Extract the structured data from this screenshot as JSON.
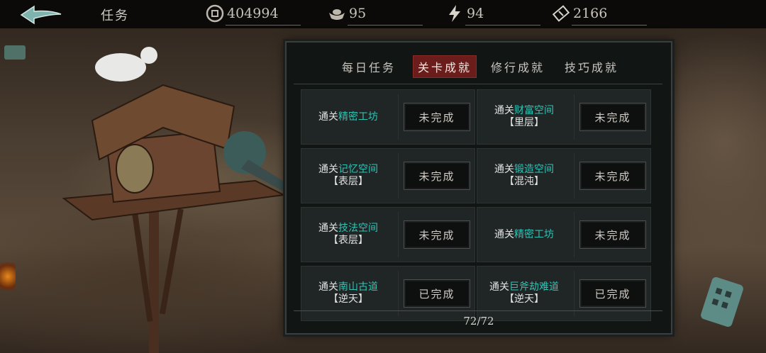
{
  "header": {
    "title": "任务",
    "resources": [
      {
        "icon": "coin-icon",
        "value": "404994"
      },
      {
        "icon": "silver-ingot-icon",
        "value": "95"
      },
      {
        "icon": "lightning-icon",
        "value": "94"
      },
      {
        "icon": "ticket-icon",
        "value": "2166"
      }
    ]
  },
  "tabs": [
    {
      "label": "每日任务",
      "active": false
    },
    {
      "label": "关卡成就",
      "active": true
    },
    {
      "label": "修行成就",
      "active": false
    },
    {
      "label": "技巧成就",
      "active": false
    }
  ],
  "achievements": [
    {
      "prefix": "通关",
      "name": "精密工坊",
      "tier": "",
      "status": "未完成"
    },
    {
      "prefix": "通关",
      "name": "财富空间",
      "tier": "【里层】",
      "status": "未完成"
    },
    {
      "prefix": "通关",
      "name": "记忆空间",
      "tier": "【表层】",
      "status": "未完成"
    },
    {
      "prefix": "通关",
      "name": "锻造空间",
      "tier": "【混沌】",
      "status": "未完成"
    },
    {
      "prefix": "通关",
      "name": "技法空间",
      "tier": "【表层】",
      "status": "未完成"
    },
    {
      "prefix": "通关",
      "name": "精密工坊",
      "tier": "",
      "status": "未完成"
    },
    {
      "prefix": "通关",
      "name": "南山古道",
      "tier": "【逆天】",
      "status": "已完成"
    },
    {
      "prefix": "通关",
      "name": "巨斧劫难道",
      "tier": "【逆天】",
      "status": "已完成"
    }
  ],
  "progress": "72/72",
  "colors": {
    "highlight": "#2ec4b6",
    "active_tab": "#6b1d1c"
  }
}
